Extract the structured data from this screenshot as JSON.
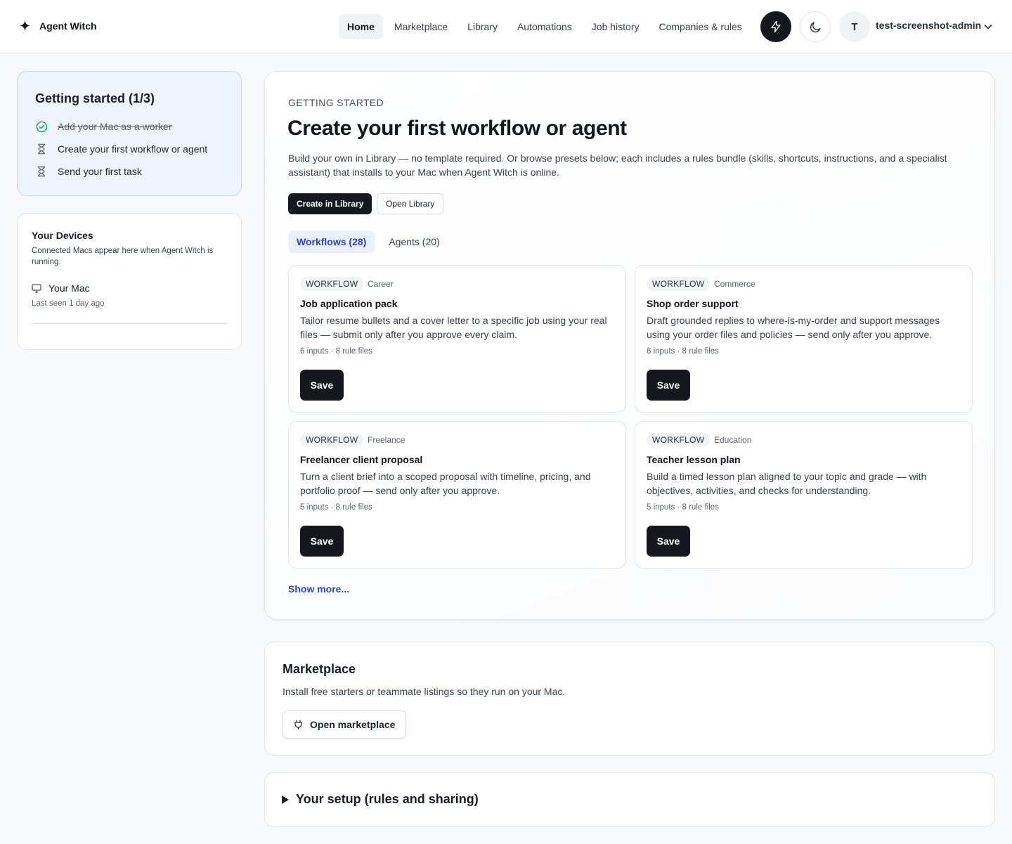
{
  "brand": {
    "name": "Agent Witch"
  },
  "nav": {
    "items": [
      {
        "label": "Home",
        "active": true
      },
      {
        "label": "Marketplace"
      },
      {
        "label": "Library"
      },
      {
        "label": "Automations"
      },
      {
        "label": "Job history"
      },
      {
        "label": "Companies & rules"
      }
    ]
  },
  "user": {
    "initial": "T",
    "name": "test-screenshot-admin"
  },
  "getting_started": {
    "title": "Getting started (1/3)",
    "items": [
      {
        "label": "Add your Mac as a worker",
        "done": true,
        "icon": "check-circle-icon"
      },
      {
        "label": "Create your first workflow or agent",
        "done": false,
        "icon": "hourglass-icon"
      },
      {
        "label": "Send your first task",
        "done": false,
        "icon": "hourglass-icon"
      }
    ]
  },
  "devices": {
    "title": "Your Devices",
    "subtitle": "Connected Macs appear here when Agent Witch is running.",
    "device_name": "Your Mac",
    "last_seen": "Last seen 1 day ago"
  },
  "main": {
    "kicker": "GETTING STARTED",
    "title": "Create your first workflow or agent",
    "description": "Build your own in Library — no template required. Or browse presets below; each includes a rules bundle (skills, shortcuts, instructions, and a specialist assistant) that installs to your Mac when Agent Witch is online.",
    "create_button": "Create in Library",
    "open_button": "Open Library",
    "tabs": [
      {
        "label": "Workflows (28)",
        "active": true
      },
      {
        "label": "Agents (20)"
      }
    ],
    "cards": [
      {
        "tag": "WORKFLOW",
        "category": "Career",
        "title": "Job application pack",
        "description": "Tailor resume bullets and a cover letter to a specific job using your real files — submit only after you approve every claim.",
        "meta": "6 inputs · 8 rule files",
        "save": "Save"
      },
      {
        "tag": "WORKFLOW",
        "category": "Commerce",
        "title": "Shop order support",
        "description": "Draft grounded replies to where-is-my-order and support messages using your order files and policies — send only after you approve.",
        "meta": "6 inputs · 8 rule files",
        "save": "Save"
      },
      {
        "tag": "WORKFLOW",
        "category": "Freelance",
        "title": "Freelancer client proposal",
        "description": "Turn a client brief into a scoped proposal with timeline, pricing, and portfolio proof — send only after you approve.",
        "meta": "5 inputs · 8 rule files",
        "save": "Save"
      },
      {
        "tag": "WORKFLOW",
        "category": "Education",
        "title": "Teacher lesson plan",
        "description": "Build a timed lesson plan aligned to your topic and grade — with objectives, activities, and checks for understanding.",
        "meta": "5 inputs · 8 rule files",
        "save": "Save"
      }
    ],
    "show_more": "Show more..."
  },
  "marketplace": {
    "title": "Marketplace",
    "description": "Install free starters or teammate listings so they run on your Mac.",
    "button": "Open marketplace"
  },
  "setup": {
    "title": "Your setup (rules and sharing)"
  },
  "colors": {
    "accent": "#2e45c9",
    "dark": "#16181d",
    "success": "#1f9d6b"
  }
}
